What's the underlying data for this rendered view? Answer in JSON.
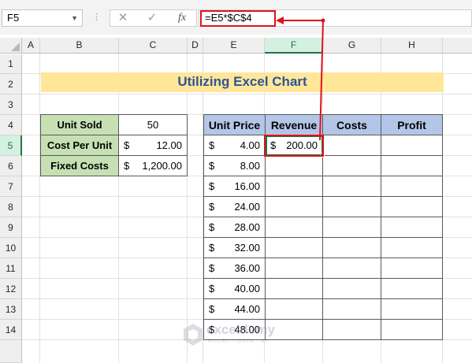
{
  "formula_bar": {
    "name_box": "F5",
    "cancel_icon": "✕",
    "enter_icon": "✓",
    "fx_label": "fx",
    "formula": "=E5*$C$4"
  },
  "columns": [
    "A",
    "B",
    "C",
    "D",
    "E",
    "F",
    "G",
    "H"
  ],
  "rows": [
    "1",
    "2",
    "3",
    "4",
    "5",
    "6",
    "7",
    "8",
    "9",
    "10",
    "11",
    "12",
    "13",
    "14"
  ],
  "selected_cell": "F5",
  "title": "Utilizing Excel Chart",
  "inputs": [
    {
      "label": "Unit Sold",
      "currency": "",
      "value": "50"
    },
    {
      "label": "Cost Per Unit",
      "currency": "$",
      "value": "12.00"
    },
    {
      "label": "Fixed Costs",
      "currency": "$",
      "value": "1,200.00"
    }
  ],
  "table": {
    "headers": [
      "Unit Price",
      "Revenue",
      "Costs",
      "Profit"
    ],
    "rows": [
      {
        "currency": "$",
        "price": "4.00",
        "revenue_currency": "$",
        "revenue": "200.00"
      },
      {
        "currency": "$",
        "price": "8.00"
      },
      {
        "currency": "$",
        "price": "16.00"
      },
      {
        "currency": "$",
        "price": "24.00"
      },
      {
        "currency": "$",
        "price": "28.00"
      },
      {
        "currency": "$",
        "price": "32.00"
      },
      {
        "currency": "$",
        "price": "36.00"
      },
      {
        "currency": "$",
        "price": "40.00"
      },
      {
        "currency": "$",
        "price": "44.00"
      },
      {
        "currency": "$",
        "price": "48.00"
      }
    ]
  },
  "watermark": {
    "name": "exceldemy",
    "tagline": "EXCEL · DATA · BI"
  },
  "colors": {
    "accent": "#e0121b",
    "selection": "#107c41",
    "title_fill": "#ffe699",
    "label_fill": "#c6e0b4",
    "header_fill": "#b4c6e7",
    "title_text": "#2f5496"
  },
  "icons": [
    "cancel-icon",
    "enter-icon",
    "function-icon",
    "dropdown-icon"
  ]
}
